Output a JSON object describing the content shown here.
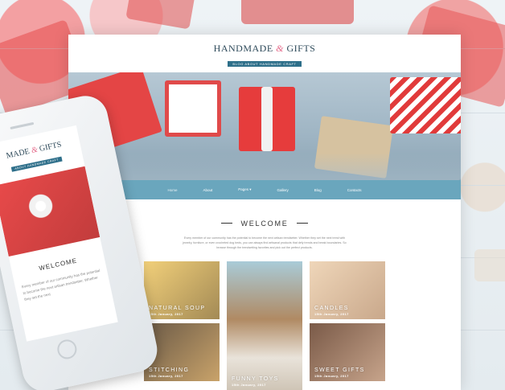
{
  "site": {
    "logo_title_a": "HANDMADE",
    "logo_amp": "&",
    "logo_title_b": "GIFTS",
    "logo_tagline": "BLOG ABOUT HANDMADE CRAFT"
  },
  "nav": {
    "items": [
      "Home",
      "About",
      "Pages",
      "Gallery",
      "Blog",
      "Contacts"
    ]
  },
  "welcome": {
    "title": "WELCOME",
    "text": "Every member of our community has the potential to become the next artisan trendsetter. Whether they set the next trend with jewelry, furniture, or even crocheted dog beds, you can always find artisanal products that defy trends and break boundaries. So browse through the trendsetting favorites and pick out the perfect products."
  },
  "tiles": [
    {
      "name": "NATURAL SOUP",
      "date": "15th January, 2017",
      "color": "#c9b17a"
    },
    {
      "name": "FUNNY TOYS",
      "date": "15th January, 2017",
      "color": "#9ec0cf"
    },
    {
      "name": "CANDLES",
      "date": "15th January, 2017",
      "color": "#d9c3aa"
    },
    {
      "name": "STITCHING",
      "date": "15th January, 2017",
      "color": "#b89968"
    },
    {
      "name": "SWEET GIFTS",
      "date": "15th January, 2017",
      "color": "#8a6a56"
    }
  ],
  "phone": {
    "logo_title_a": "MADE",
    "logo_amp": "&",
    "logo_title_b": "GIFTS",
    "logo_tagline": "ABOUT HANDMADE CRAFT",
    "welcome_title": "WELCOME",
    "welcome_text": "Every member of our community has the potential to become the next artisan trendsetter. Whether they set the next"
  },
  "colors": {
    "nav": "#6aa6bd",
    "accent": "#e46a8a",
    "ribbon": "#2e6f8a"
  }
}
